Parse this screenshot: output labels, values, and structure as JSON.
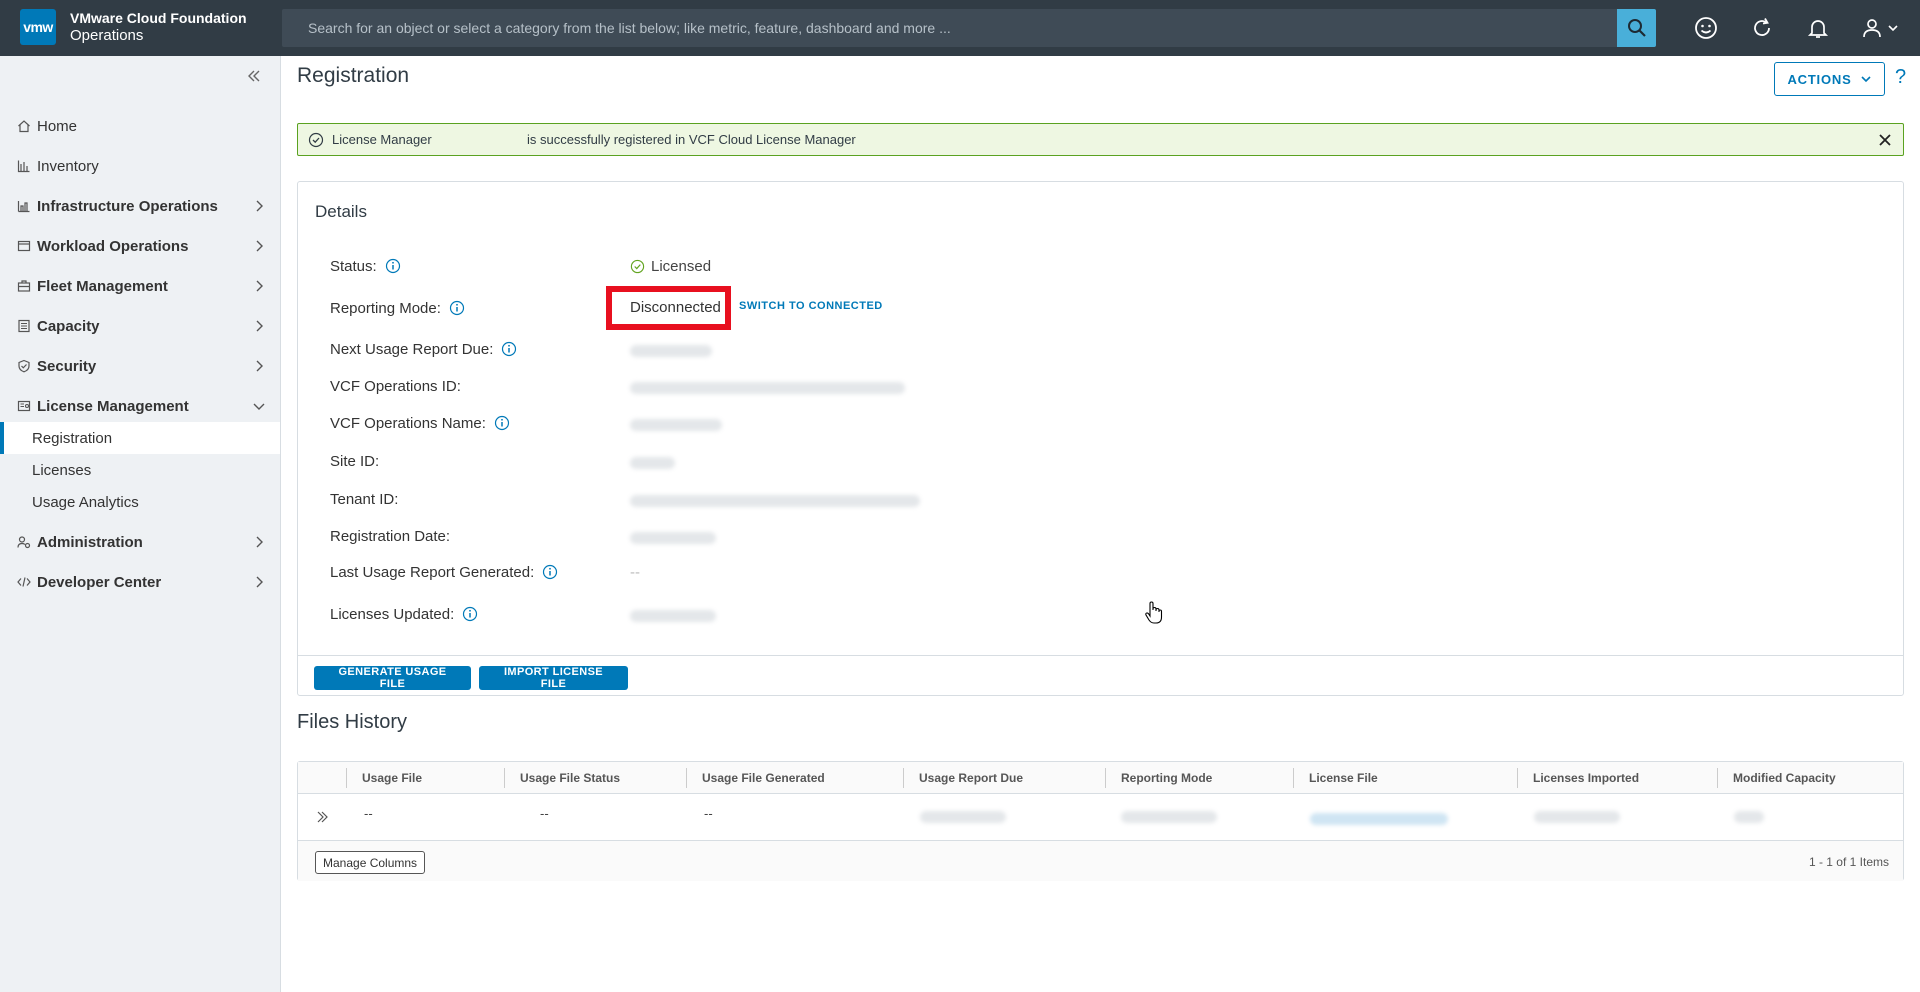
{
  "header": {
    "logo_text": "vmw",
    "brand_line1": "VMware Cloud Foundation",
    "brand_line2": "Operations",
    "search_placeholder": "Search for an object or select a category from the list below; like metric, feature, dashboard and more ...",
    "icons": [
      "search-icon",
      "smiley-icon",
      "refresh-icon",
      "bell-icon",
      "user-icon"
    ]
  },
  "sidebar": {
    "items": [
      {
        "label": "Home",
        "icon": "home-icon"
      },
      {
        "label": "Inventory",
        "icon": "inventory-icon"
      },
      {
        "label": "Infrastructure Operations",
        "icon": "infra-icon"
      },
      {
        "label": "Workload Operations",
        "icon": "workload-icon"
      },
      {
        "label": "Fleet Management",
        "icon": "fleet-icon"
      },
      {
        "label": "Capacity",
        "icon": "capacity-icon"
      },
      {
        "label": "Security",
        "icon": "shield-icon"
      },
      {
        "label": "License Management",
        "icon": "license-icon"
      },
      {
        "label": "Administration",
        "icon": "admin-icon"
      },
      {
        "label": "Developer Center",
        "icon": "code-icon"
      }
    ],
    "subitems": [
      "Registration",
      "Licenses",
      "Usage Analytics"
    ],
    "active_subitem": "Registration"
  },
  "main": {
    "title": "Registration",
    "actions_label": "ACTIONS",
    "help_label": "?",
    "alert": {
      "name": "License Manager",
      "message": "is successfully registered in VCF Cloud License Manager"
    },
    "details": {
      "title": "Details",
      "rows": [
        {
          "label": "Status:"
        },
        {
          "label": "Reporting Mode:"
        },
        {
          "label": "Next Usage Report Due:"
        },
        {
          "label": "VCF Operations ID:"
        },
        {
          "label": "VCF Operations Name:"
        },
        {
          "label": "Site ID:"
        },
        {
          "label": "Tenant ID:"
        },
        {
          "label": "Registration Date:"
        },
        {
          "label": "Last Usage Report Generated:"
        },
        {
          "label": "Licenses Updated:"
        }
      ],
      "status_value": "Licensed",
      "reporting_mode_value": "Disconnected",
      "switch_link": "SWITCH TO CONNECTED",
      "last_report_value": "--",
      "generate_button": "GENERATE USAGE FILE",
      "import_button": "IMPORT LICENSE FILE"
    },
    "files_history": {
      "title": "Files History",
      "columns": [
        "Usage File",
        "Usage File Status",
        "Usage File Generated",
        "Usage Report Due",
        "Reporting Mode",
        "License File",
        "Licenses Imported",
        "Modified Capacity"
      ],
      "row": [
        "--",
        "--",
        "--"
      ],
      "manage_columns": "Manage Columns",
      "pagination": "1 - 1 of 1 Items"
    }
  }
}
